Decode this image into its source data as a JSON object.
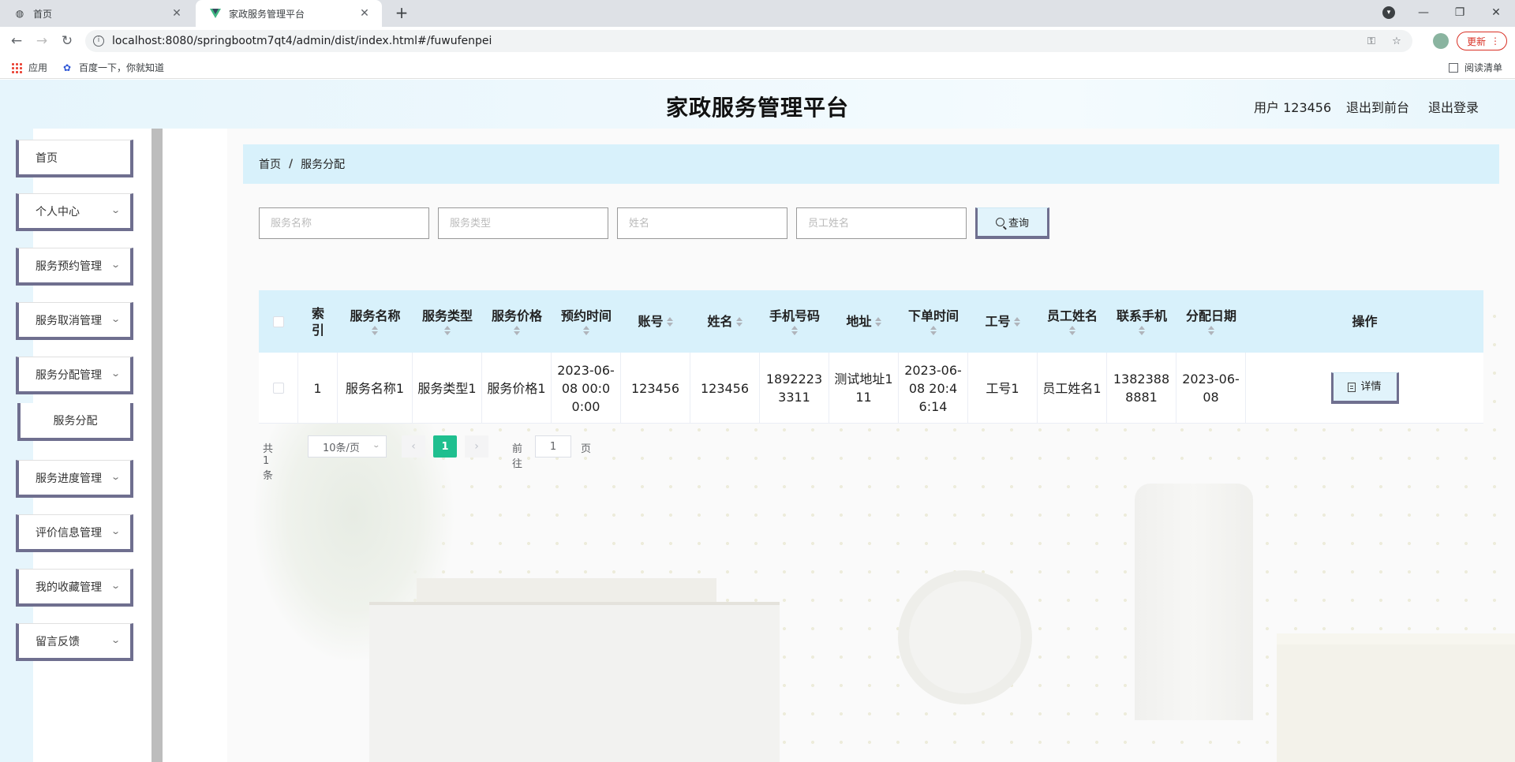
{
  "browser": {
    "tabs": [
      {
        "title": "首页",
        "icon": "globe-icon"
      },
      {
        "title": "家政服务管理平台",
        "icon": "vue-logo-icon"
      }
    ],
    "url": "localhost:8080/springbootm7qt4/admin/dist/index.html#/fuwufenpei",
    "update_label": "更新",
    "bookmarks": [
      "应用",
      "百度一下，你就知道"
    ],
    "reading_list": "阅读清单"
  },
  "header": {
    "title": "家政服务管理平台",
    "user": "用户 123456",
    "to_front": "退出到前台",
    "logout": "退出登录"
  },
  "sidebar": {
    "items": [
      {
        "label": "首页",
        "has_children": false
      },
      {
        "label": "个人中心",
        "has_children": true
      },
      {
        "label": "服务预约管理",
        "has_children": true
      },
      {
        "label": "服务取消管理",
        "has_children": true
      },
      {
        "label": "服务分配管理",
        "has_children": true
      },
      {
        "label": "服务进度管理",
        "has_children": true
      },
      {
        "label": "评价信息管理",
        "has_children": true
      },
      {
        "label": "我的收藏管理",
        "has_children": true
      },
      {
        "label": "留言反馈",
        "has_children": true
      }
    ],
    "subitem": "服务分配"
  },
  "breadcrumb": {
    "home": "首页",
    "separator": "/",
    "current": "服务分配"
  },
  "search": {
    "placeholders": [
      "服务名称",
      "服务类型",
      "姓名",
      "员工姓名"
    ],
    "button": "查询"
  },
  "table": {
    "headers": [
      "索\n引",
      "服务名称",
      "服务类型",
      "服务价格",
      "预约时间",
      "账号",
      "姓名",
      "手机号码",
      "地址",
      "下单时间",
      "工号",
      "员工姓名",
      "联系手机",
      "分配日期",
      "操作"
    ],
    "rows": [
      [
        "1",
        "服务名称1",
        "服务类型1",
        "服务价格1",
        "2023-06-08 00:00:00",
        "123456",
        "123456",
        "18922233311",
        "测试地址111",
        "2023-06-08 20:46:14",
        "工号1",
        "员工姓名1",
        "13823888881",
        "2023-06-08"
      ]
    ],
    "action_label": "详情"
  },
  "pagination": {
    "total": "共 1 条",
    "page_size": "10条/页",
    "current": "1",
    "goto_prefix": "前往",
    "goto_value": "1",
    "goto_suffix": "页"
  },
  "colors": {
    "accent_green": "#1fbf8f",
    "header_bg": "#d8f1fb",
    "button_border": "#6f6f8f"
  }
}
